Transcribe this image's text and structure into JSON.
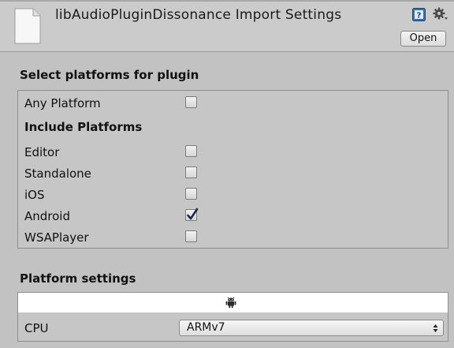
{
  "header": {
    "title": "libAudioPluginDissonance Import Settings",
    "open_label": "Open",
    "icons": [
      "document-icon",
      "help-book-icon",
      "gear-icon"
    ]
  },
  "platforms": {
    "heading": "Select platforms for plugin",
    "any_platform": {
      "label": "Any Platform",
      "checked": false
    },
    "include_heading": "Include Platforms",
    "items": [
      {
        "label": "Editor",
        "checked": false
      },
      {
        "label": "Standalone",
        "checked": false
      },
      {
        "label": "iOS",
        "checked": false
      },
      {
        "label": "Android",
        "checked": true
      },
      {
        "label": "WSAPlayer",
        "checked": false
      }
    ]
  },
  "platform_settings": {
    "heading": "Platform settings",
    "active_tab_icon": "android-icon",
    "cpu_label": "CPU",
    "cpu_value": "ARMv7"
  },
  "colors": {
    "background": "#c2c2c2",
    "check_mark": "#1a2a4a",
    "help_icon": "#3a6ea5"
  }
}
